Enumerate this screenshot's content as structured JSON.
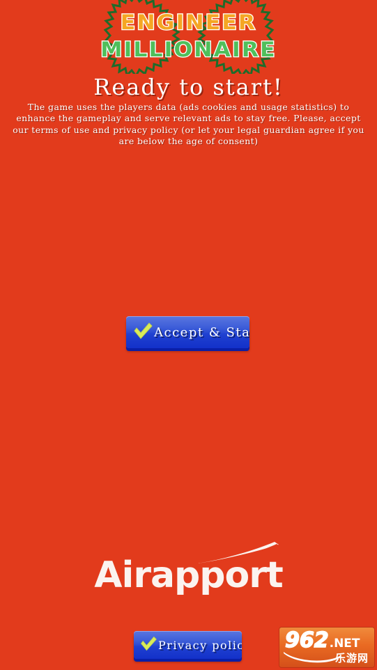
{
  "theme": {
    "background_color": "#E23B1C",
    "button_color": "#2347D4",
    "check_color": "#D9EB5B",
    "logo_top_color": "#F9A227",
    "logo_bottom_color": "#4FBF5B",
    "text_color": "#FFFFFF"
  },
  "logo": {
    "line1": "ENGINEER",
    "line2": "MILLIONAIRE",
    "gear_icon": "gear-outline-icon"
  },
  "heading": {
    "title": "Ready to start!"
  },
  "consent": {
    "body": "The game uses the players data (ads cookies and usage statistics) to enhance the gameplay and serve relevant ads to stay free. Please, accept our terms of use and privacy policy (or let your legal guardian agree if you are below the age of consent)"
  },
  "buttons": {
    "accept": {
      "label": "Accept & Start!",
      "icon": "check-icon"
    },
    "privacy": {
      "label": "Privacy policy",
      "icon": "check-icon"
    }
  },
  "branding": {
    "name": "Airapport",
    "swoosh_icon": "swoosh-icon"
  },
  "watermark": {
    "number": "962",
    "domain": ".NET",
    "subtitle": "乐游网",
    "swoosh_icon": "swoosh-icon"
  }
}
